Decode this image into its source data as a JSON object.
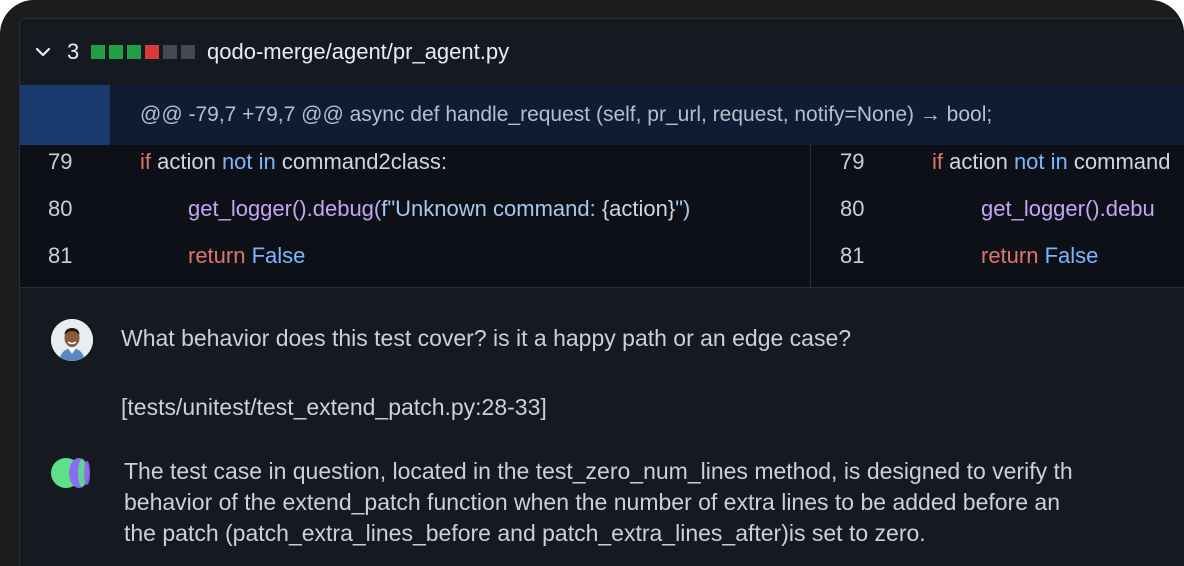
{
  "file": {
    "count": "3",
    "path": "qodo-merge/agent/pr_agent.py",
    "blocks": [
      "#22a046",
      "#22a046",
      "#22a046",
      "#d93a3a",
      "#444a52",
      "#444a52"
    ]
  },
  "hunk": {
    "header": "@@ -79,7 +79,7 @@ async def handle_request (self, pr_url, request, notify=None) → bool;"
  },
  "code": {
    "left": [
      {
        "num": "79",
        "indent": "",
        "segments": [
          [
            "if",
            "kw"
          ],
          [
            " action ",
            "pl"
          ],
          [
            "not in",
            "kb"
          ],
          [
            " command2class:",
            "pl"
          ]
        ]
      },
      {
        "num": "80",
        "indent": "x",
        "segments": [
          [
            "get_logger().debug(",
            "fn"
          ],
          [
            "f\"Unknown command: ",
            "st"
          ],
          [
            "{action}",
            "pl"
          ],
          [
            "\")",
            "st"
          ]
        ]
      },
      {
        "num": "81",
        "indent": "x",
        "segments": [
          [
            "return ",
            "kw"
          ],
          [
            "False",
            "kb"
          ]
        ]
      }
    ],
    "right": [
      {
        "num": "79",
        "indent": "",
        "segments": [
          [
            "if",
            "kw"
          ],
          [
            " action ",
            "pl"
          ],
          [
            "not in",
            "kb"
          ],
          [
            " command",
            "pl"
          ]
        ]
      },
      {
        "num": "80",
        "indent": "x",
        "segments": [
          [
            "get_logger().debu",
            "fn"
          ]
        ]
      },
      {
        "num": "81",
        "indent": "x",
        "segments": [
          [
            "return ",
            "kw"
          ],
          [
            "False",
            "kb"
          ]
        ]
      }
    ]
  },
  "conversation": {
    "question": "What behavior does this test cover? is it a happy path or an edge case?",
    "reference": "[tests/unitest/test_extend_patch.py:28-33]",
    "answer_lines": [
      "The test case in question, located in the test_zero_num_lines method, is designed to verify th",
      "behavior of the extend_patch function when the number of extra lines to be added before an",
      "the patch (patch_extra_lines_before and patch_extra_lines_after)is set to zero."
    ]
  },
  "icons": {
    "chevron": "chevron-down-icon",
    "avatar": "user-avatar",
    "bot": "qodo-logo-icon"
  }
}
